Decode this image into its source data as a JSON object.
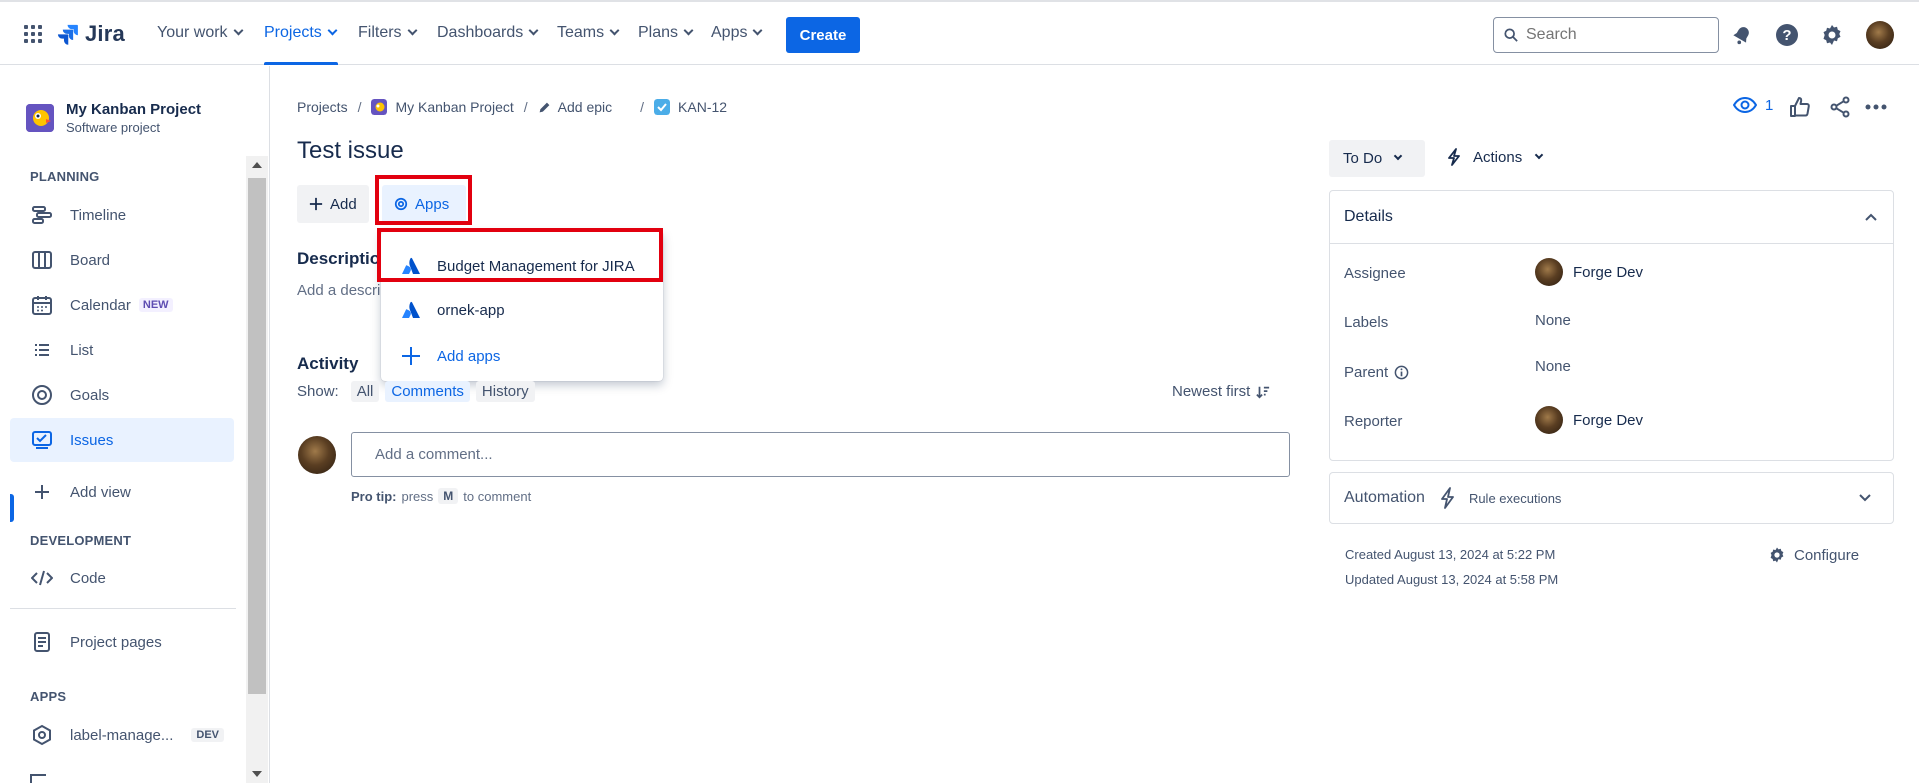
{
  "topnav": {
    "logo_text": "Jira",
    "items": [
      "Your work",
      "Projects",
      "Filters",
      "Dashboards",
      "Teams",
      "Plans",
      "Apps"
    ],
    "active_item": "Projects",
    "create_label": "Create",
    "search_placeholder": "Search",
    "accent": "#0c66e4"
  },
  "sidebar": {
    "project_name": "My Kanban Project",
    "project_type": "Software project",
    "planning_label": "PLANNING",
    "items": {
      "timeline": "Timeline",
      "board": "Board",
      "calendar": "Calendar",
      "calendar_badge": "NEW",
      "list": "List",
      "goals": "Goals",
      "issues": "Issues",
      "add_view": "Add view",
      "code": "Code",
      "project_pages": "Project pages",
      "label_manager": "label-manage...",
      "label_manager_badge": "DEV"
    },
    "development_label": "DEVELOPMENT",
    "apps_label": "APPS"
  },
  "breadcrumb": {
    "projects": "Projects",
    "project": "My Kanban Project",
    "epic": "Add epic",
    "issue_key": "KAN-12"
  },
  "issue": {
    "title": "Test issue",
    "add_label": "Add",
    "apps_label": "Apps",
    "description_label": "Description",
    "description_placeholder": "Add a description..."
  },
  "apps_menu": {
    "items": [
      "Budget Management for JIRA",
      "ornek-app"
    ],
    "add_apps": "Add apps"
  },
  "activity": {
    "title": "Activity",
    "show_label": "Show:",
    "filters": [
      "All",
      "Comments",
      "History"
    ],
    "selected_filter": "Comments",
    "sort_label": "Newest first",
    "comment_placeholder": "Add a comment...",
    "pro_tip_label": "Pro tip:",
    "pro_tip_press": "press",
    "pro_tip_key": "M",
    "pro_tip_suffix": "to comment"
  },
  "right": {
    "watch_count": "1",
    "status": "To Do",
    "actions_label": "Actions",
    "details_title": "Details",
    "fields": {
      "assignee_label": "Assignee",
      "assignee_value": "Forge Dev",
      "labels_label": "Labels",
      "labels_value": "None",
      "parent_label": "Parent",
      "parent_value": "None",
      "reporter_label": "Reporter",
      "reporter_value": "Forge Dev"
    },
    "automation_label": "Automation",
    "rule_executions": "Rule executions",
    "created": "Created August 13, 2024 at 5:22 PM",
    "updated": "Updated August 13, 2024 at 5:58 PM",
    "configure_label": "Configure"
  }
}
